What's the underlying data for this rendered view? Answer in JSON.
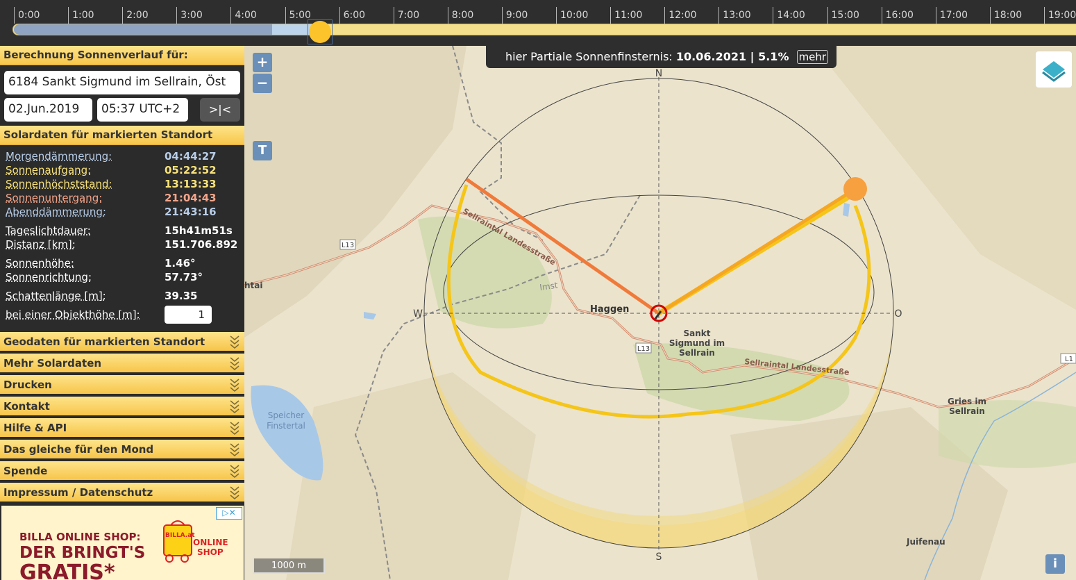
{
  "timeline": {
    "hours": [
      "0:00",
      "1:00",
      "2:00",
      "3:00",
      "4:00",
      "5:00",
      "6:00",
      "7:00",
      "8:00",
      "9:00",
      "10:00",
      "11:00",
      "12:00",
      "13:00",
      "14:00",
      "15:00",
      "16:00",
      "17:00",
      "18:00",
      "19:00"
    ]
  },
  "sidebar": {
    "calc_header": "Berechnung Sonnenverlauf für:",
    "location_value": "6184 Sankt Sigmund im Sellrain, Öst",
    "date_value": "02.Jun.2019",
    "time_value": "05:37 UTC+2",
    "now_button": ">|<",
    "solar_header": "Solardaten für markierten Standort",
    "solar": {
      "dawn_label": "Morgendämmerung:",
      "dawn_value": "04:44:27",
      "sunrise_label": "Sonnenaufgang:",
      "sunrise_value": "05:22:52",
      "noon_label": "Sonnenhöchststand:",
      "noon_value": "13:13:33",
      "sunset_label": "Sonnenuntergang:",
      "sunset_value": "21:04:43",
      "dusk_label": "Abenddämmerung:",
      "dusk_value": "21:43:16",
      "daylight_label": "Tageslichtdauer:",
      "daylight_value": "15h41m51s",
      "distance_label": "Distanz [km]:",
      "distance_value": "151.706.892",
      "elevation_label": "Sonnenhöhe:",
      "elevation_value": "1.46°",
      "azimuth_label": "Sonnenrichtung:",
      "azimuth_value": "57.73°",
      "shadow_label": "Schattenlänge [m]:",
      "shadow_value": "39.35",
      "objheight_label": "bei einer Objekthöhe [m]:",
      "objheight_value": "1"
    },
    "panels": [
      "Geodaten für markierten Standort",
      "Mehr Solardaten",
      "Drucken",
      "Kontakt",
      "Hilfe & API",
      "Das gleiche für den Mond",
      "Spende",
      "Impressum / Datenschutz"
    ],
    "ad": {
      "line1": "BILLA ONLINE SHOP:",
      "line2": "DER BRINGT'S",
      "line3": "GRATIS*",
      "logo_text1": "BILLA.at",
      "logo_text2": "ONLINE",
      "logo_text3": "SHOP",
      "badge": "▷✕"
    }
  },
  "map": {
    "zoom_in": "+",
    "zoom_out": "−",
    "t_button": "T",
    "eclipse_prefix": "hier Partiale Sonnenfinsternis:",
    "eclipse_value": "10.06.2021 | 5.1%",
    "eclipse_more": "mehr",
    "info_button": "i",
    "scale": "1000 m",
    "compass": {
      "n": "N",
      "s": "S",
      "w": "W",
      "o": "O"
    },
    "labels": {
      "haggen": "Haggen",
      "sankt1": "Sankt",
      "sankt2": "Sigmund im",
      "sankt3": "Sellrain",
      "road1": "Sellraintal Landesstraße",
      "road2": "Sellraintal Landesstraße",
      "l13a": "L13",
      "l13b": "L13",
      "l1": "L1",
      "imst": "Imst",
      "speicher1": "Speicher",
      "speicher2": "Finstertal",
      "gries1": "Gries im",
      "gries2": "Sellrain",
      "juifenau": "Juifenau",
      "htai": "htai"
    },
    "colors": {
      "sunrise_line": "#f5a623",
      "sunset_line": "#f07a3a",
      "sun": "#f7a040",
      "path": "#f5c518",
      "marker": "#d00000"
    }
  }
}
